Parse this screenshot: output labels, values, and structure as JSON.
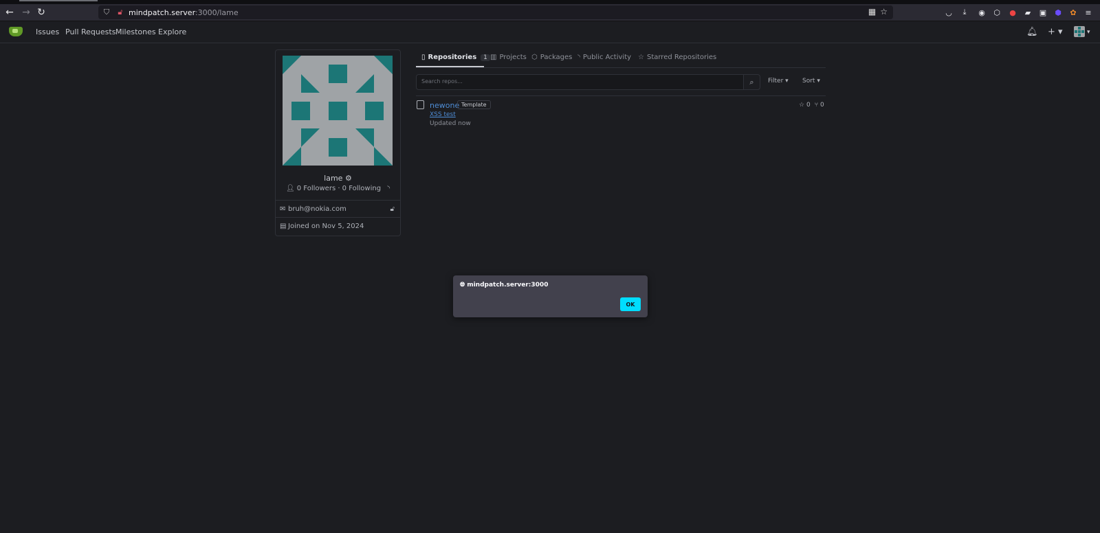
{
  "browser": {
    "url_host": "mindpatch.server",
    "url_rest": ":3000/lame"
  },
  "nav": {
    "items": [
      "Issues",
      "Pull Requests",
      "Milestones",
      "Explore"
    ]
  },
  "profile": {
    "username": "lame",
    "followers_text": "0 Followers · 0 Following",
    "email": "bruh@nokia.com",
    "joined": "Joined on Nov 5, 2024"
  },
  "tabs": [
    {
      "label": "Repositories",
      "count": "1"
    },
    {
      "label": "Projects"
    },
    {
      "label": "Packages"
    },
    {
      "label": "Public Activity"
    },
    {
      "label": "Starred Repositories"
    }
  ],
  "search": {
    "placeholder": "Search repos...",
    "filter_label": "Filter",
    "sort_label": "Sort"
  },
  "repos": [
    {
      "name": "newone",
      "badge": "Template",
      "description": "XSS test",
      "updated": "Updated now",
      "stars": "0",
      "forks": "0"
    }
  ],
  "dialog": {
    "origin": "mindpatch.server:3000",
    "ok_label": "OK"
  },
  "colors": {
    "accent": "#00ddff",
    "link": "#4e8dd6",
    "avatar_bg": "#9fa3a6",
    "avatar_fg": "#1c7676"
  }
}
